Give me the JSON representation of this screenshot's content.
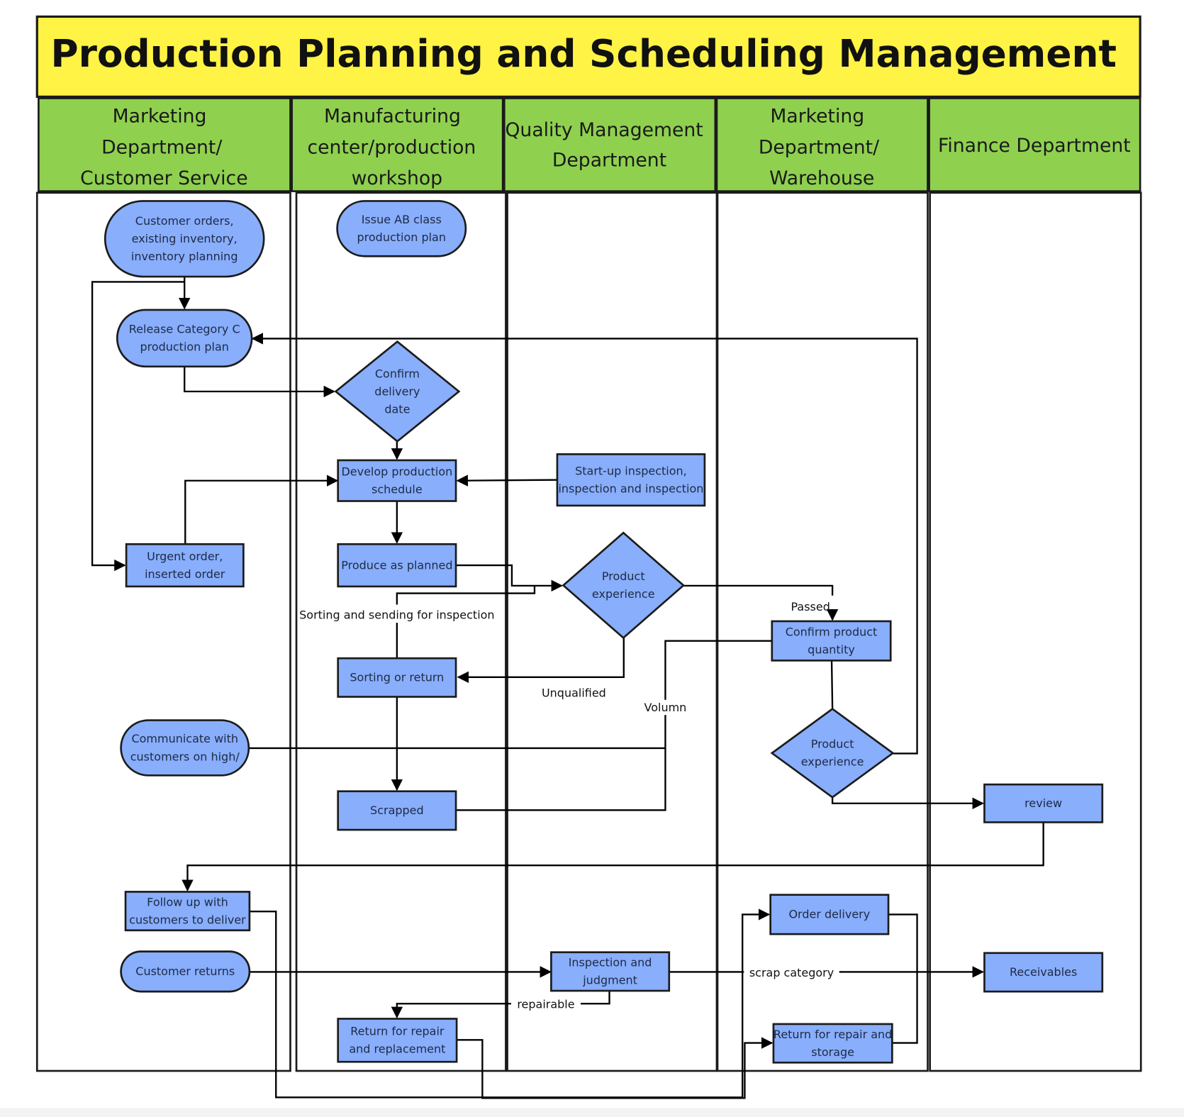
{
  "title": "Production Planning and Scheduling Management",
  "colors": {
    "title_bg": "#fff345",
    "lane_header_bg": "#8fd14f",
    "node_fill": "#88aefc",
    "stroke": "#1b1b1b"
  },
  "lanes": [
    {
      "id": "cs",
      "lines": [
        "Marketing",
        "Department/",
        "Customer Service"
      ]
    },
    {
      "id": "mfg",
      "lines": [
        "Manufacturing",
        "center/production",
        "workshop"
      ]
    },
    {
      "id": "qm",
      "lines": [
        "Quality Management",
        "Department"
      ]
    },
    {
      "id": "wh",
      "lines": [
        "Marketing",
        "Department/",
        "Warehouse"
      ]
    },
    {
      "id": "fin",
      "lines": [
        "Finance Department"
      ]
    }
  ],
  "nodes": [
    {
      "id": "customer-orders",
      "shape": "terminator",
      "lane": "cs",
      "lines": [
        "Customer orders,",
        "existing inventory,",
        "inventory planning"
      ]
    },
    {
      "id": "issue-ab-plan",
      "shape": "terminator",
      "lane": "mfg",
      "lines": [
        "Issue AB class",
        "production plan"
      ]
    },
    {
      "id": "release-c-plan",
      "shape": "terminator",
      "lane": "cs",
      "lines": [
        "Release Category C",
        "production plan"
      ]
    },
    {
      "id": "confirm-delivery-date",
      "shape": "decision",
      "lane": "mfg",
      "lines": [
        "Confirm",
        "delivery",
        "date"
      ]
    },
    {
      "id": "develop-schedule",
      "shape": "process",
      "lane": "mfg",
      "lines": [
        "Develop production",
        "schedule"
      ]
    },
    {
      "id": "startup-inspection",
      "shape": "process",
      "lane": "qm",
      "lines": [
        "Start-up inspection,",
        "inspection and inspection"
      ]
    },
    {
      "id": "urgent-order",
      "shape": "process",
      "lane": "cs",
      "lines": [
        "Urgent order,",
        "inserted order"
      ]
    },
    {
      "id": "produce-as-planned",
      "shape": "process",
      "lane": "mfg",
      "lines": [
        "Produce as planned"
      ]
    },
    {
      "id": "product-experience-qm",
      "shape": "decision",
      "lane": "qm",
      "lines": [
        "Product",
        "experience"
      ]
    },
    {
      "id": "confirm-quantity",
      "shape": "process",
      "lane": "wh",
      "lines": [
        "Confirm product",
        "quantity"
      ]
    },
    {
      "id": "sorting-or-return",
      "shape": "process",
      "lane": "mfg",
      "lines": [
        "Sorting or return"
      ]
    },
    {
      "id": "communicate-customers",
      "shape": "terminator",
      "lane": "cs",
      "lines": [
        "Communicate with",
        "customers on high/"
      ]
    },
    {
      "id": "product-experience-wh",
      "shape": "decision",
      "lane": "wh",
      "lines": [
        "Product",
        "experience"
      ]
    },
    {
      "id": "scrapped",
      "shape": "process",
      "lane": "mfg",
      "lines": [
        "Scrapped"
      ]
    },
    {
      "id": "review",
      "shape": "process",
      "lane": "fin",
      "lines": [
        "review"
      ]
    },
    {
      "id": "follow-up-delivery",
      "shape": "process",
      "lane": "cs",
      "lines": [
        "Follow up with",
        "customers to deliver"
      ]
    },
    {
      "id": "order-delivery",
      "shape": "process",
      "lane": "wh",
      "lines": [
        "Order delivery"
      ]
    },
    {
      "id": "customer-returns",
      "shape": "terminator",
      "lane": "cs",
      "lines": [
        "Customer returns"
      ]
    },
    {
      "id": "inspection-judgment",
      "shape": "process",
      "lane": "qm",
      "lines": [
        "Inspection and",
        "judgment"
      ]
    },
    {
      "id": "receivables",
      "shape": "process",
      "lane": "fin",
      "lines": [
        "Receivables"
      ]
    },
    {
      "id": "return-repair-replacement",
      "shape": "process",
      "lane": "mfg",
      "lines": [
        "Return for repair",
        "and replacement"
      ]
    },
    {
      "id": "return-repair-storage",
      "shape": "process",
      "lane": "wh",
      "lines": [
        "Return for repair and",
        "storage"
      ]
    }
  ],
  "edge_labels": {
    "sorting_sending": "Sorting and sending for inspection",
    "passed": "Passed",
    "unqualified": "Unqualified",
    "volumn": "Volumn",
    "repairable": "repairable",
    "scrap_category": "scrap category"
  }
}
